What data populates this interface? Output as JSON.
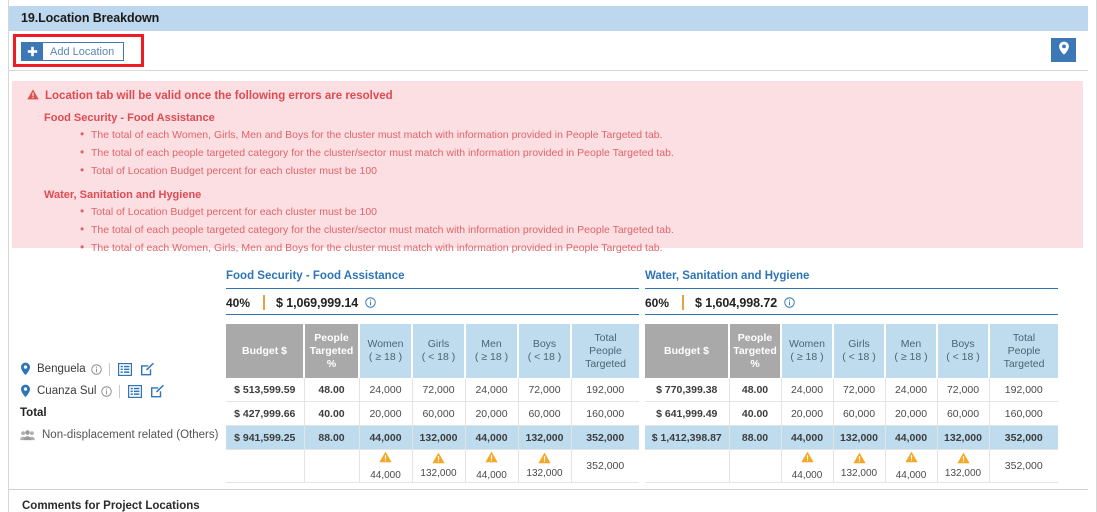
{
  "section": {
    "title": "19.Location Breakdown"
  },
  "toolbar": {
    "add_location_label": "Add Location",
    "plus_icon": "plus-icon",
    "map_icon": "map-pin-icon"
  },
  "errors": {
    "heading": "Location tab will be valid once the following errors are resolved",
    "warning_icon": "warning-triangle-icon",
    "groups": [
      {
        "cluster": "Food Security - Food Assistance",
        "items": [
          "The total of each Women, Girls, Men and Boys for the cluster must match with information provided in People Targeted tab.",
          "The total of each people targeted category for the cluster/sector must match with information provided in People Targeted tab.",
          "Total of Location Budget percent for each cluster must be 100"
        ]
      },
      {
        "cluster": "Water, Sanitation and Hygiene",
        "items": [
          "Total of Location Budget percent for each cluster must be 100",
          "The total of each people targeted category for the cluster/sector must match with information provided in People Targeted tab.",
          "The total of each Women, Girls, Men and Boys for the cluster must match with information provided in People Targeted tab."
        ]
      }
    ]
  },
  "locations": {
    "rows": [
      {
        "name": "Benguela",
        "pin_icon": "map-pin-icon",
        "info_icon": "info-icon",
        "list_icon": "list-form-icon",
        "edit_icon": "edit-pencil-icon"
      },
      {
        "name": "Cuanza Sul",
        "pin_icon": "map-pin-icon",
        "info_icon": "info-icon",
        "list_icon": "list-form-icon",
        "edit_icon": "edit-pencil-icon"
      }
    ],
    "total_label": "Total",
    "non_displacement_label": "Non-displacement related (Others)",
    "group_icon": "people-group-icon"
  },
  "table_headers": [
    "Budget $",
    "People Targeted %",
    "Women ( ≥ 18 )",
    "Girls ( < 18 )",
    "Men ( ≥ 18 )",
    "Boys ( < 18 )",
    "Total People Targeted"
  ],
  "table_headers_lines": [
    [
      "Budget $"
    ],
    [
      "People",
      "Targeted",
      "%"
    ],
    [
      "Women",
      "( ≥ 18 )"
    ],
    [
      "Girls",
      "( < 18 )"
    ],
    [
      "Men",
      "( ≥ 18 )"
    ],
    [
      "Boys",
      "( < 18 )"
    ],
    [
      "Total",
      "People",
      "Targeted"
    ]
  ],
  "clusters": [
    {
      "id": "food-security",
      "title": "Food Security - Food Assistance",
      "percent": "40%",
      "amount": "$ 1,069,999.14",
      "info_icon": "info-icon",
      "rows": [
        [
          "$ 513,599.59",
          "48.00",
          "24,000",
          "72,000",
          "24,000",
          "72,000",
          "192,000"
        ],
        [
          "$ 427,999.66",
          "40.00",
          "20,000",
          "60,000",
          "20,000",
          "60,000",
          "160,000"
        ]
      ],
      "total_row": [
        "$ 941,599.25",
        "88.00",
        "44,000",
        "132,000",
        "44,000",
        "132,000",
        "352,000"
      ],
      "warn_row": {
        "budget": "",
        "people_pct": "",
        "women": "44,000",
        "girls": "132,000",
        "men": "44,000",
        "boys": "132,000",
        "total": "352,000",
        "warning_icon": "warning-triangle-icon"
      }
    },
    {
      "id": "wash",
      "title": "Water, Sanitation and Hygiene",
      "percent": "60%",
      "amount": "$ 1,604,998.72",
      "info_icon": "info-icon",
      "rows": [
        [
          "$ 770,399.38",
          "48.00",
          "24,000",
          "72,000",
          "24,000",
          "72,000",
          "192,000"
        ],
        [
          "$ 641,999.49",
          "40.00",
          "20,000",
          "60,000",
          "20,000",
          "60,000",
          "160,000"
        ]
      ],
      "total_row": [
        "$ 1,412,398.87",
        "88.00",
        "44,000",
        "132,000",
        "44,000",
        "132,000",
        "352,000"
      ],
      "warn_row": {
        "budget": "",
        "people_pct": "",
        "women": "44,000",
        "girls": "132,000",
        "men": "44,000",
        "boys": "132,000",
        "total": "352,000",
        "warning_icon": "warning-triangle-icon"
      }
    }
  ],
  "bottom": {
    "comments_label": "Comments for Project Locations"
  },
  "colors": {
    "section_bar": "#bdd7ee",
    "accent_blue": "#2e75b6",
    "button_blue": "#3b78b5",
    "error_bg": "#fbdfe2",
    "error_text": "#d9534f",
    "header_gray": "#a9a9a9",
    "header_blue": "#bfdcef",
    "warning_orange": "#f5a623",
    "highlight_red": "#ee1c25",
    "summary_separator": "#e8a33d"
  }
}
